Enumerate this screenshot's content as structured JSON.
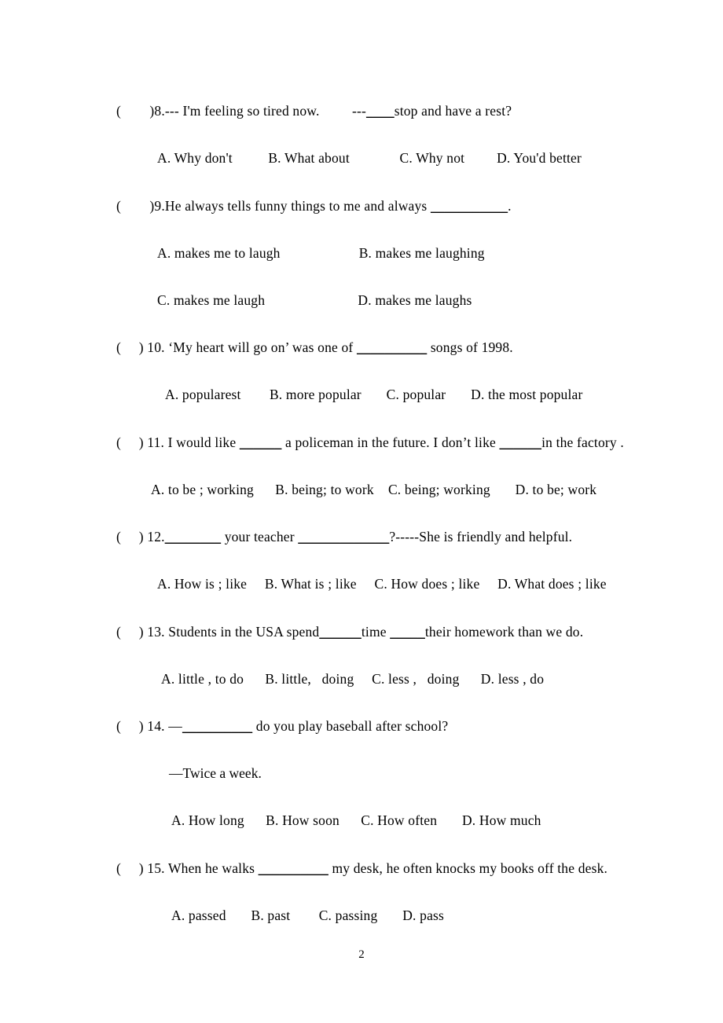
{
  "document": {
    "page_number": "2",
    "type": "english-exam-multiple-choice"
  },
  "questions": [
    {
      "id": "q8",
      "marker": "(        )8.",
      "stem": "--- I'm feeling so tired now.",
      "stem_tail_prefix": "---",
      "stem_blank": "____",
      "stem_tail": "stop and have a rest?",
      "options_line1": "A. Why don't          B. What about              C. Why not         D. You'd better"
    },
    {
      "id": "q9",
      "marker": "(        )9.",
      "stem": "He always tells funny things to me and always",
      "stem_blank": "___________",
      "stem_tail": ".",
      "options_line1": "A. makes me to laugh                      B. makes me laughing",
      "options_line2": "C. makes me laugh                          D. makes me laughs"
    },
    {
      "id": "q10",
      "marker": "(     ) 10.",
      "stem": "‘My heart will go on’ was one of",
      "stem_blank": "__________",
      "stem_tail": "songs of 1998.",
      "options_line1": "A. popularest        B. more popular       C. popular       D. the most popular"
    },
    {
      "id": "q11",
      "marker": "(     ) 11.",
      "stem": "I would like",
      "stem_blank": "______",
      "stem_tail": "a policeman in the future. I don’t like",
      "stem_blank2": "______",
      "stem_tail2": "in the factory .",
      "options_line1": "A. to be ; working      B. being; to work    C. being; working       D. to be; work"
    },
    {
      "id": "q12",
      "marker": "(     ) 12.",
      "stem_blank": "________",
      "stem_mid": "your teacher",
      "stem_blank2": "_____________",
      "stem_tail": "?-----She is friendly and helpful.",
      "options_line1": "A. How is ; like     B. What is ; like     C. How does ; like     D. What does ; like"
    },
    {
      "id": "q13",
      "marker": "(     ) 13.",
      "stem": "Students in the USA spend",
      "stem_blank": "______",
      "stem_mid": "time",
      "stem_blank2": "_____",
      "stem_tail": "their homework than we do.",
      "options_line1": "A. little , to do      B. little,   doing     C. less ,   doing      D. less , do"
    },
    {
      "id": "q14",
      "marker": "(     ) 14.",
      "stem_dash": "—",
      "stem_blank": "__________",
      "stem_tail": "do you play baseball after school?",
      "answer_line": "—Twice a week.",
      "options_line1": "A. How long      B. How soon      C. How often       D. How much"
    },
    {
      "id": "q15",
      "marker": "(     ) 15.",
      "stem": " When he walks",
      "stem_blank": "__________",
      "stem_tail": "my desk, he often knocks my books off the desk.",
      "options_line1": "A. passed       B. past        C. passing       D. pass"
    }
  ]
}
